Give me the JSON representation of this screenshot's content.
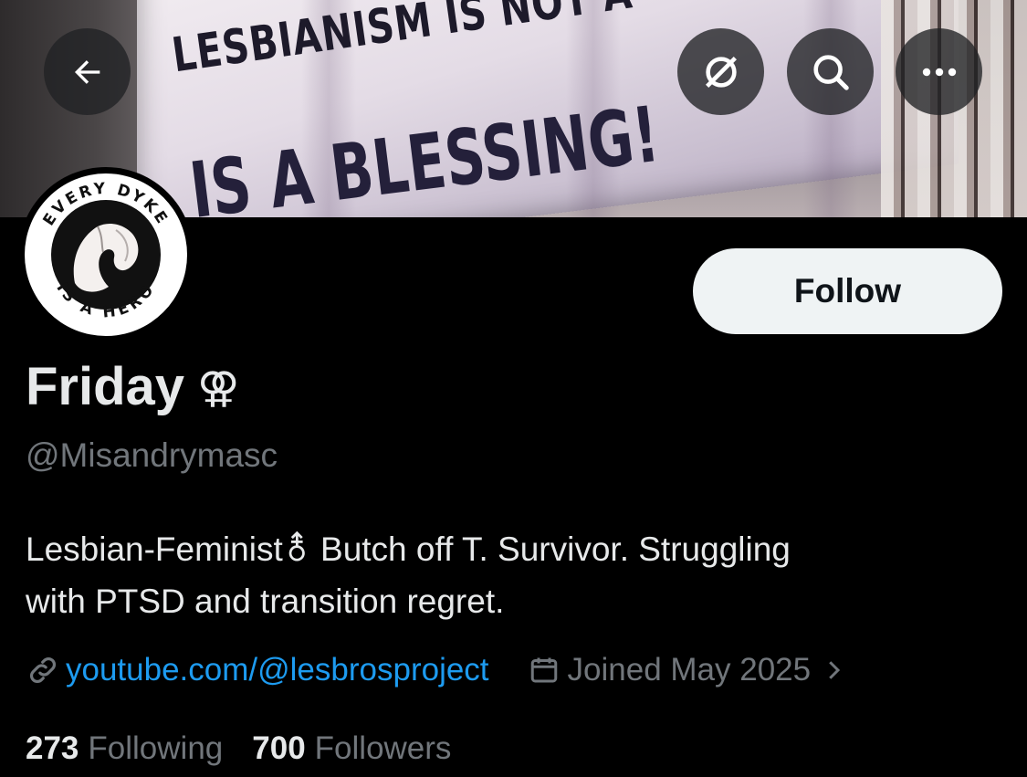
{
  "banner": {
    "text_line1": "LESBIANISM IS NOT A",
    "text_line2": "IS A  BLESSING!"
  },
  "top_actions": [
    "back-arrow-icon",
    "translate-off-icon",
    "search-icon",
    "more-icon"
  ],
  "avatar": {
    "ring_text_top": "EVERY DYKE",
    "ring_text_bottom": "IS A HERO"
  },
  "profile": {
    "follow_label": "Follow",
    "display_name": "Friday",
    "name_symbol": "⚢",
    "handle": "@Misandrymasc",
    "bio_line1": "Lesbian-Feminist⚨ Butch off T. Survivor. Struggling",
    "bio_line2": "with PTSD and transition regret.",
    "website": "youtube.com/@lesbrosproject",
    "joined": "Joined May 2025"
  },
  "stats": {
    "following_count": "273",
    "following_label": "Following",
    "followers_count": "700",
    "followers_label": "Followers"
  },
  "colors": {
    "background": "#000000",
    "text": "#e7e9ea",
    "secondary": "#71767b",
    "link": "#1d9bf0",
    "follow_bg": "#eff3f4"
  }
}
